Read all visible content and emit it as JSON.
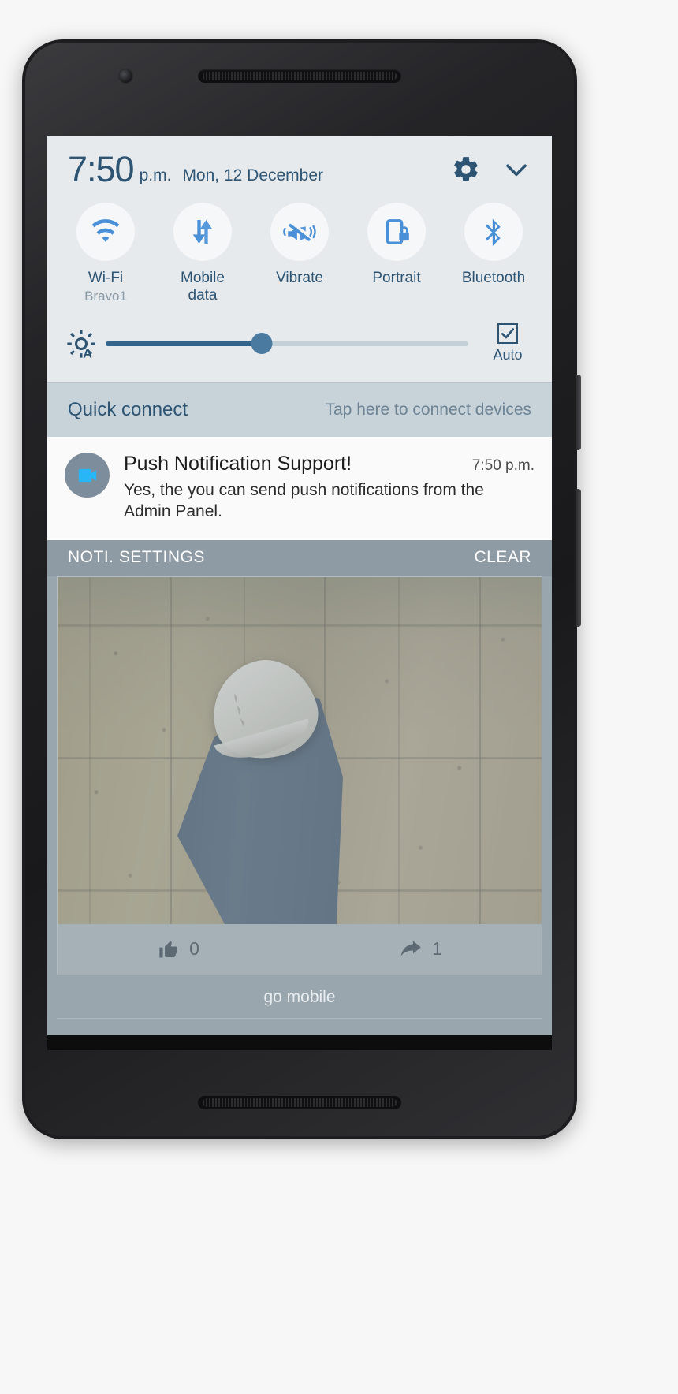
{
  "statusbar": {
    "time": "7:50",
    "ampm": "p.m.",
    "date": "Mon, 12 December",
    "settings_icon": "gear-icon",
    "collapse_icon": "chevron-down-icon"
  },
  "quick_settings": {
    "toggles": [
      {
        "label": "Wi-Fi",
        "sub": "Bravo1",
        "icon": "wifi-icon",
        "active": true
      },
      {
        "label": "Mobile\ndata",
        "sub": "",
        "icon": "mobile-data-icon",
        "active": true
      },
      {
        "label": "Vibrate",
        "sub": "",
        "icon": "vibrate-icon",
        "active": true
      },
      {
        "label": "Portrait",
        "sub": "",
        "icon": "rotation-lock-icon",
        "active": true
      },
      {
        "label": "Bluetooth",
        "sub": "",
        "icon": "bluetooth-icon",
        "active": true
      }
    ],
    "brightness": {
      "icon": "auto-brightness-icon",
      "value_percent": 43,
      "auto_label": "Auto",
      "auto_checked": true
    }
  },
  "quick_connect": {
    "title": "Quick connect",
    "hint": "Tap here to connect devices"
  },
  "notification": {
    "app_icon": "video-camera-icon",
    "title": "Push Notification Support!",
    "time": "7:50 p.m.",
    "text": "Yes, the you can send push notifications from the Admin Panel.",
    "action_settings": "NOTI. SETTINGS",
    "action_clear": "CLEAR"
  },
  "app_behind": {
    "media_type": "video",
    "like_icon": "thumbs-up-icon",
    "like_count": "0",
    "share_icon": "share-arrow-icon",
    "share_count": "1",
    "footer_label": "go mobile"
  },
  "colors": {
    "accent_blue": "#4a90d9",
    "panel_bg": "#e6eaed",
    "text_blue": "#2d5473",
    "quick_connect_bg": "#c7d2d9"
  }
}
